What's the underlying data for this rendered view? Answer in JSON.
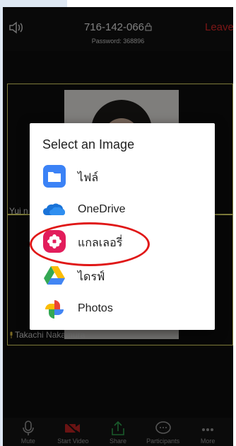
{
  "topbar": {
    "meeting_id": "716-142-066",
    "password": "Password: 368896",
    "leave_label": "Leave"
  },
  "tiles": [
    {
      "name": "Yui n"
    },
    {
      "name": "Takachi Nakamura"
    }
  ],
  "toolbar": {
    "items": [
      {
        "label": "Mute",
        "icon": "microphone-icon"
      },
      {
        "label": "Start Video",
        "icon": "video-off-icon"
      },
      {
        "label": "Share",
        "icon": "share-icon"
      },
      {
        "label": "Participants",
        "icon": "chat-bubble-icon"
      },
      {
        "label": "More",
        "icon": "more-dots-icon"
      }
    ]
  },
  "dialog": {
    "title": "Select an Image",
    "options": [
      {
        "label": "ไฟล์",
        "icon": "folder-icon"
      },
      {
        "label": "OneDrive",
        "icon": "onedrive-cloud-icon"
      },
      {
        "label": "แกลเลอรี่",
        "icon": "gallery-flower-icon"
      },
      {
        "label": "ไดรฟ์",
        "icon": "google-drive-icon"
      },
      {
        "label": "Photos",
        "icon": "google-photos-icon"
      }
    ]
  },
  "colors": {
    "leave": "#e02828",
    "highlight": "#e01717",
    "tile_border": "#e5e06a",
    "share_green": "#2ea44f"
  }
}
